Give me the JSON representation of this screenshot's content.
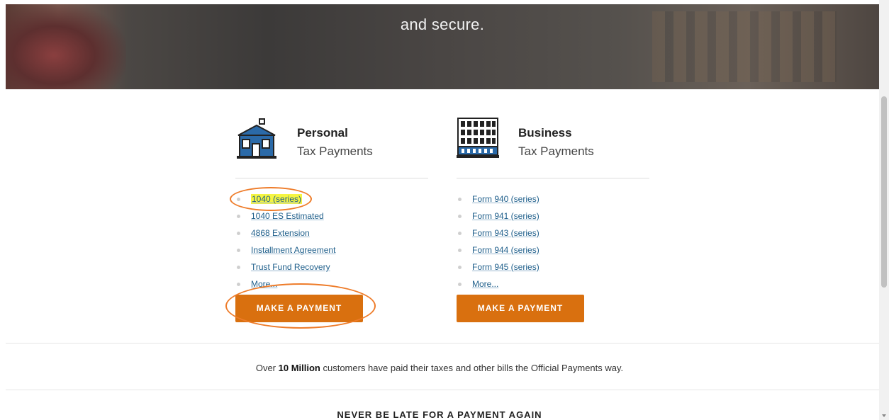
{
  "hero": {
    "text": "and secure."
  },
  "personal": {
    "title": "Personal",
    "subtitle": "Tax Payments",
    "icon": "house-icon",
    "links": [
      "1040 (series)",
      "1040 ES Estimated",
      "4868 Extension",
      "Installment Agreement",
      "Trust Fund Recovery",
      "More..."
    ],
    "button": "MAKE A PAYMENT"
  },
  "business": {
    "title": "Business",
    "subtitle": "Tax Payments",
    "icon": "office-building-icon",
    "links": [
      "Form 940 (series)",
      "Form 941 (series)",
      "Form 943 (series)",
      "Form 944 (series)",
      "Form 945 (series)",
      "More..."
    ],
    "button": "MAKE A PAYMENT"
  },
  "stats": {
    "prefix": "Over ",
    "highlight": "10 Million",
    "suffix": " customers have paid their taxes and other bills the Official Payments way."
  },
  "footer": {
    "heading": "NEVER BE LATE FOR A PAYMENT AGAIN"
  },
  "colors": {
    "accent": "#d9700f",
    "link": "#1f5f8b",
    "highlight": "#f5f542",
    "annotation": "#ee7c2a"
  }
}
